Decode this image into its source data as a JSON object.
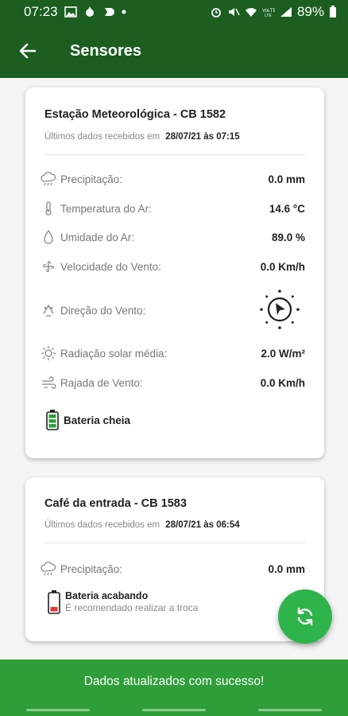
{
  "status_bar": {
    "time": "07:23",
    "battery": "89%"
  },
  "app_bar": {
    "title": "Sensores"
  },
  "stations": [
    {
      "title": "Estação Meteorológica - CB 1582",
      "last_data_label": "Últimos dados recebidos em",
      "last_data_value": "28/07/21 às 07:15",
      "rows": [
        {
          "icon": "cloud-rain-icon",
          "label": "Precipitação:",
          "value": "0.0 mm"
        },
        {
          "icon": "thermometer-icon",
          "label": "Temperatura do Ar:",
          "value": "14.6 °C"
        },
        {
          "icon": "droplet-icon",
          "label": "Umidade do Ar:",
          "value": "89.0 %"
        },
        {
          "icon": "fan-icon",
          "label": "Velocidade do Vento:",
          "value": "0.0 Km/h"
        },
        {
          "icon": "wind-direction-icon",
          "label": "Direção do Vento:",
          "value": ""
        },
        {
          "icon": "sun-icon",
          "label": "Radiação solar média:",
          "value": "2.0 W/m²"
        },
        {
          "icon": "wind-gust-icon",
          "label": "Rajada de Vento:",
          "value": "0.0 Km/h"
        }
      ],
      "battery": {
        "label": "Bateria cheia",
        "status": "full",
        "color": "#2e9e3a"
      }
    },
    {
      "title": "Café da entrada - CB 1583",
      "last_data_label": "Últimos dados recebidos em",
      "last_data_value": "28/07/21 às 06:54",
      "rows": [
        {
          "icon": "cloud-rain-icon",
          "label": "Precipitação:",
          "value": "0.0 mm"
        }
      ],
      "battery": {
        "label": "Bateria acabando",
        "note": "É recomendado realizar a troca",
        "status": "low",
        "color": "#e53935"
      }
    }
  ],
  "toast": {
    "message": "Dados atualizados com sucesso!"
  },
  "colors": {
    "primary_dark": "#1b5e20",
    "accent": "#2eb44a",
    "toast": "#2e9e3a"
  }
}
